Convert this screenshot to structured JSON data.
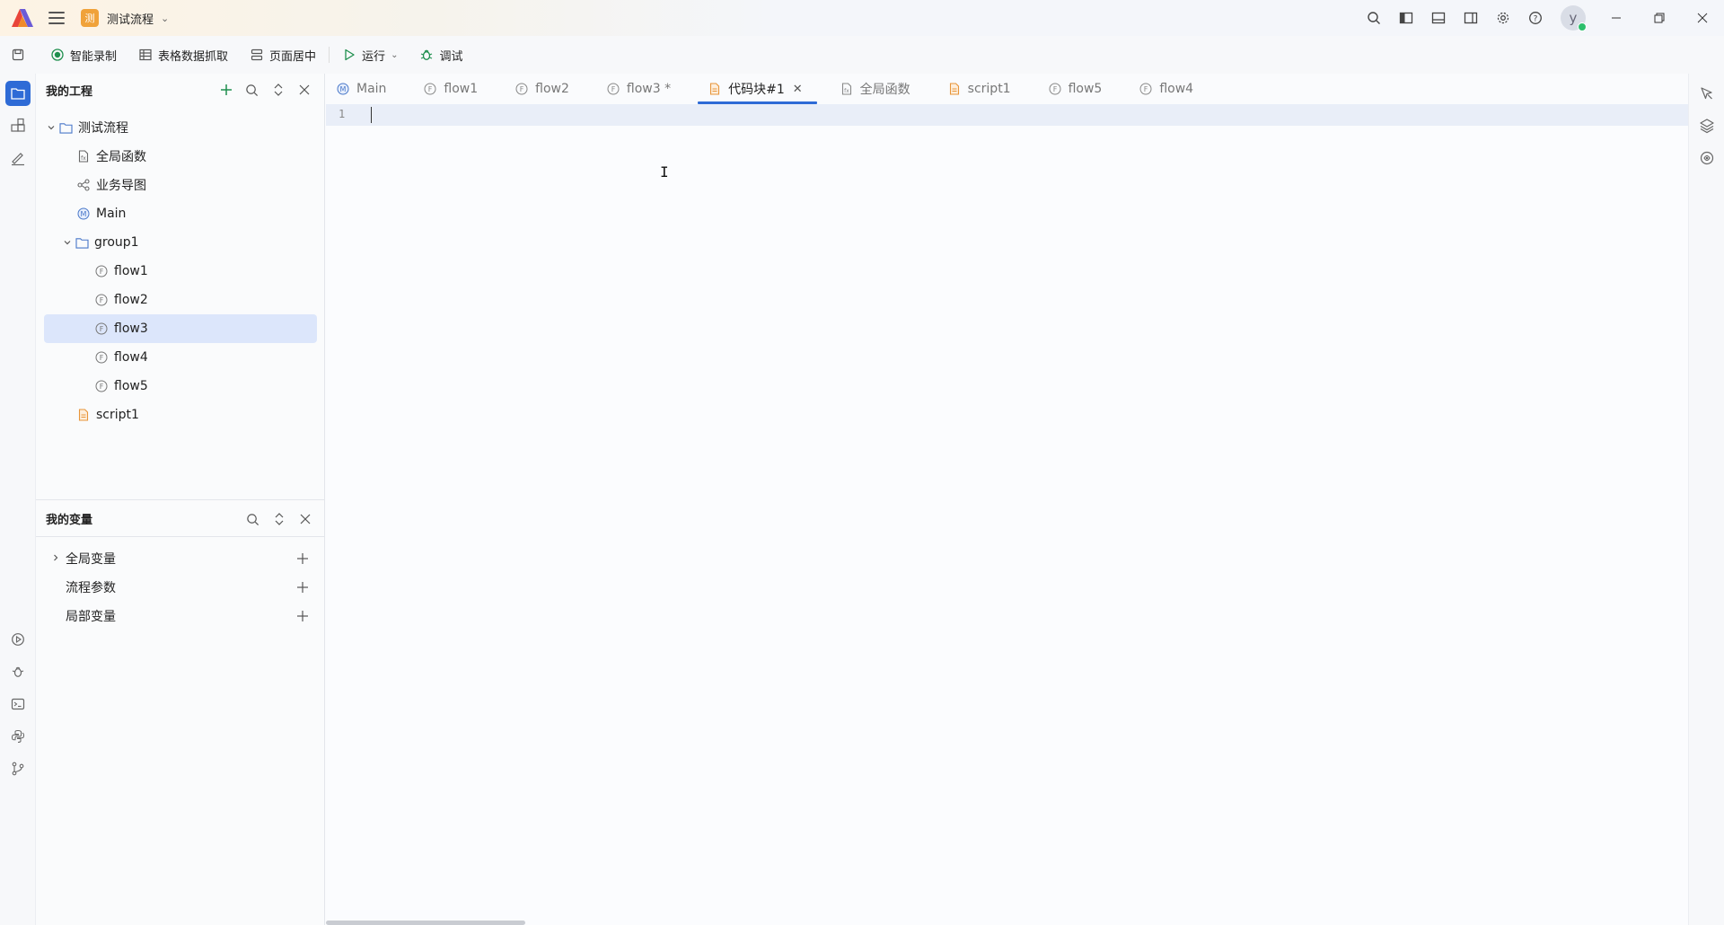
{
  "titlebar": {
    "project_badge": "测",
    "project_name": "测试流程",
    "avatar_letter": "y"
  },
  "toolbar": {
    "record": "智能录制",
    "table_capture": "表格数据抓取",
    "center_page": "页面居中",
    "run": "运行",
    "debug": "调试"
  },
  "explorer": {
    "title": "我的工程",
    "tree": {
      "root": "测试流程",
      "global_functions": "全局函数",
      "business_map": "业务导图",
      "main": "Main",
      "group": "group1",
      "flows": [
        "flow1",
        "flow2",
        "flow3",
        "flow4",
        "flow5"
      ],
      "script": "script1"
    }
  },
  "variables": {
    "title": "我的变量",
    "items": [
      "全局变量",
      "流程参数",
      "局部变量"
    ]
  },
  "tabs": [
    {
      "label": "Main",
      "icon": "main-icon"
    },
    {
      "label": "flow1",
      "icon": "flow-icon"
    },
    {
      "label": "flow2",
      "icon": "flow-icon"
    },
    {
      "label": "flow3 *",
      "icon": "flow-icon"
    },
    {
      "label": "代码块#1",
      "icon": "code-block-icon",
      "active": true
    },
    {
      "label": "全局函数",
      "icon": "global-function-icon"
    },
    {
      "label": "script1",
      "icon": "script-icon"
    },
    {
      "label": "flow5",
      "icon": "flow-icon"
    },
    {
      "label": "flow4",
      "icon": "flow-icon"
    }
  ],
  "editor": {
    "line_number": "1"
  },
  "colors": {
    "accent": "#2e6bd6",
    "selection": "#dce6fb",
    "badge": "#f0a23a"
  }
}
